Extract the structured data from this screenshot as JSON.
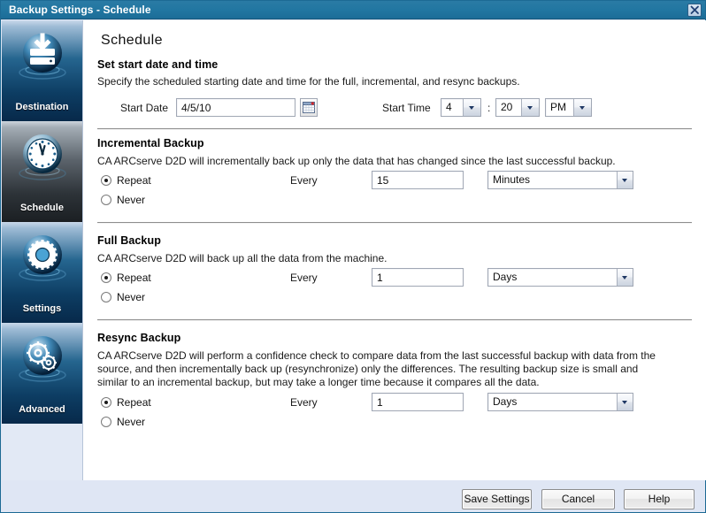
{
  "window": {
    "title": "Backup Settings - Schedule",
    "close_icon": "close-icon",
    "accent_color": "#2176a1",
    "sidebar_selected_color": "#5c646c",
    "sidebar_color": "#25658f"
  },
  "sidebar": {
    "items": [
      {
        "label": "Destination",
        "icon": "hard-drive-download-icon",
        "selected": false
      },
      {
        "label": "Schedule",
        "icon": "clock-icon",
        "selected": true
      },
      {
        "label": "Settings",
        "icon": "gear-icon",
        "selected": false
      },
      {
        "label": "Advanced",
        "icon": "gears-icon",
        "selected": false
      }
    ]
  },
  "page": {
    "title": "Schedule"
  },
  "start_section": {
    "heading": "Set start date and time",
    "description": "Specify the scheduled starting date and time for the full, incremental, and resync backups.",
    "start_date_label": "Start Date",
    "start_date_value": "4/5/10",
    "calendar_icon": "calendar-icon",
    "start_time_label": "Start Time",
    "time_separator": ":",
    "hour_value": "4",
    "minute_value": "20",
    "meridiem_value": "PM"
  },
  "incremental_section": {
    "heading": "Incremental Backup",
    "description": "CA ARCserve D2D will incrementally back up only the data that has changed since the last successful backup.",
    "repeat_label": "Repeat",
    "never_label": "Never",
    "repeat_selected": true,
    "every_label": "Every",
    "interval_value": "15",
    "unit_value": "Minutes"
  },
  "full_section": {
    "heading": "Full Backup",
    "description": "CA ARCserve D2D will back up all the data from the machine.",
    "repeat_label": "Repeat",
    "never_label": "Never",
    "repeat_selected": true,
    "every_label": "Every",
    "interval_value": "1",
    "unit_value": "Days"
  },
  "resync_section": {
    "heading": "Resync Backup",
    "description_line1": "CA ARCserve D2D will perform a confidence check to compare data from the last successful backup with data from the",
    "description_line2": "source, and then incrementally back up (resynchronize) only the differences. The resulting backup size is small and",
    "description_line3": "similar to an incremental backup, but may take a longer time because it compares all the data.",
    "repeat_label": "Repeat",
    "never_label": "Never",
    "repeat_selected": true,
    "every_label": "Every",
    "interval_value": "1",
    "unit_value": "Days"
  },
  "footer": {
    "save_label": "Save Settings",
    "cancel_label": "Cancel",
    "help_label": "Help"
  }
}
